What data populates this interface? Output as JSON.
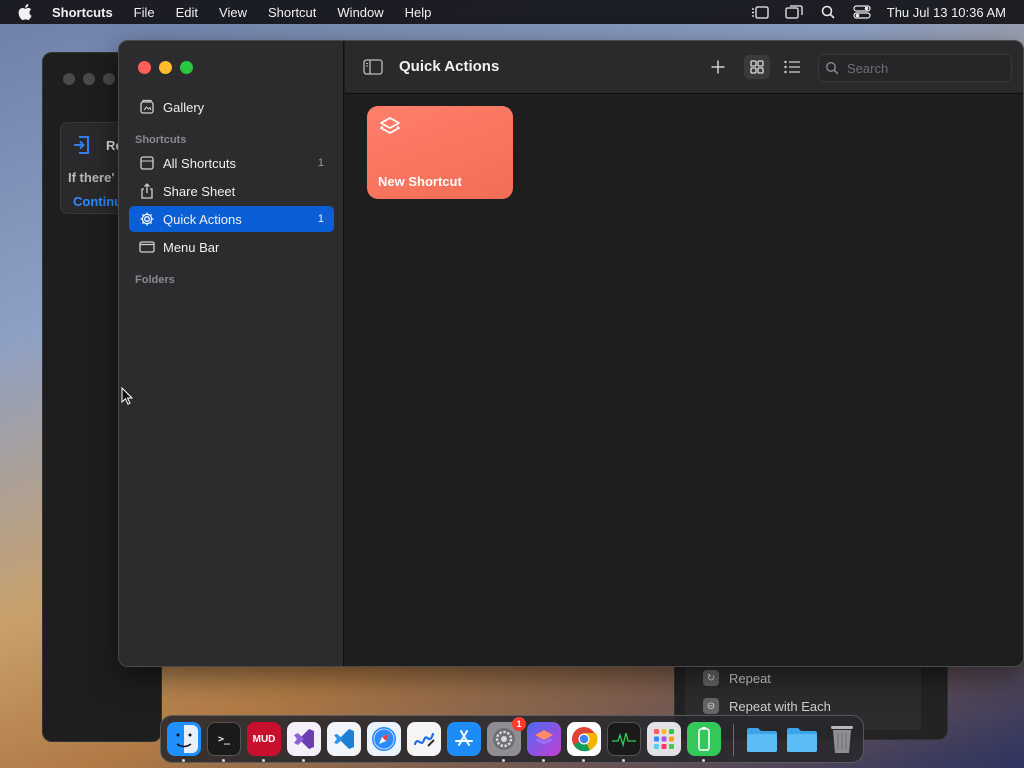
{
  "menubar": {
    "app_name": "Shortcuts",
    "items": [
      "File",
      "Edit",
      "View",
      "Shortcut",
      "Window",
      "Help"
    ],
    "clock": "Thu Jul 13  10:36 AM"
  },
  "background_window": {
    "card_title": "Re",
    "card_text": "If there'",
    "card_link": "Continu",
    "panel_items": [
      "Repeat",
      "Repeat with Each"
    ]
  },
  "sidebar": {
    "gallery": "Gallery",
    "section_shortcuts": "Shortcuts",
    "items": [
      {
        "label": "All Shortcuts",
        "count": "1",
        "icon": "tray-icon"
      },
      {
        "label": "Share Sheet",
        "count": "",
        "icon": "share-icon"
      },
      {
        "label": "Quick Actions",
        "count": "1",
        "icon": "gear-icon"
      },
      {
        "label": "Menu Bar",
        "count": "",
        "icon": "menubar-icon"
      }
    ],
    "section_folders": "Folders"
  },
  "toolbar": {
    "title": "Quick Actions",
    "search_placeholder": "Search"
  },
  "shortcut_card": {
    "label": "New Shortcut",
    "color": "#f26d55"
  },
  "dock": {
    "apps": [
      {
        "name": "Finder",
        "icon": "finder-icon",
        "color": "#1e90ff"
      },
      {
        "name": "Terminal",
        "icon": "terminal-icon",
        "color": "#1a1a1a",
        "text": ">_"
      },
      {
        "name": "MUD",
        "icon": "mud-icon",
        "color": "#c8102e",
        "text": "MUD"
      },
      {
        "name": "Visual Studio",
        "icon": "visual-studio-icon",
        "color": "#6b3fb0"
      },
      {
        "name": "VS Code",
        "icon": "vscode-icon",
        "color": "#1e7fd4"
      },
      {
        "name": "Safari",
        "icon": "safari-icon",
        "color": "#2e8bff"
      },
      {
        "name": "Freeform",
        "icon": "freeform-icon",
        "color": "#f5f5f5"
      },
      {
        "name": "App Store",
        "icon": "app-store-icon",
        "color": "#1d8cf8"
      },
      {
        "name": "System Settings",
        "icon": "settings-icon",
        "color": "#8e8e93",
        "badge": "1"
      },
      {
        "name": "Shortcuts",
        "icon": "shortcuts-icon",
        "color": "#6a4bd1"
      },
      {
        "name": "Chrome",
        "icon": "chrome-icon",
        "color": "#ffffff"
      },
      {
        "name": "Activity Monitor",
        "icon": "activity-monitor-icon",
        "color": "#1a1a1a"
      },
      {
        "name": "Launchpad",
        "icon": "launchpad-icon",
        "color": "#d0d0d0"
      },
      {
        "name": "Battery",
        "icon": "battery-icon",
        "color": "#34c759"
      },
      {
        "name": "Folder",
        "icon": "folder-icon",
        "color": "#4db3f5"
      },
      {
        "name": "Folder",
        "icon": "folder-icon",
        "color": "#4db3f5"
      },
      {
        "name": "Trash",
        "icon": "trash-icon",
        "color": "#9a9a9e"
      }
    ]
  }
}
